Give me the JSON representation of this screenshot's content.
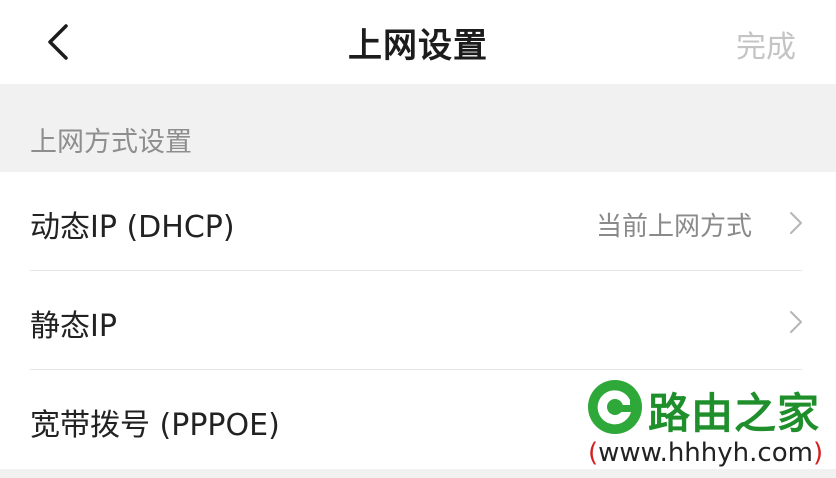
{
  "navbar": {
    "title": "上网设置",
    "done_label": "完成",
    "back_icon": "chevron-left-icon"
  },
  "section": {
    "title": "上网方式设置"
  },
  "rows": [
    {
      "label": "动态IP (DHCP)",
      "value": "当前上网方式",
      "icon": "chevron-right-icon"
    },
    {
      "label": "静态IP",
      "value": "",
      "icon": "chevron-right-icon"
    },
    {
      "label": "宽带拨号 (PPPOE)",
      "value": "",
      "icon": "chevron-right-icon"
    }
  ],
  "watermark": {
    "brand": "路由之家",
    "url_open": "(",
    "url": "www.hhhyh.com",
    "url_close": ")"
  },
  "colors": {
    "accent_green": "#1f8f2c",
    "section_bg": "#f1f1f1",
    "secondary_text": "#8a8a8a",
    "disabled_text": "#c4c4c4"
  }
}
